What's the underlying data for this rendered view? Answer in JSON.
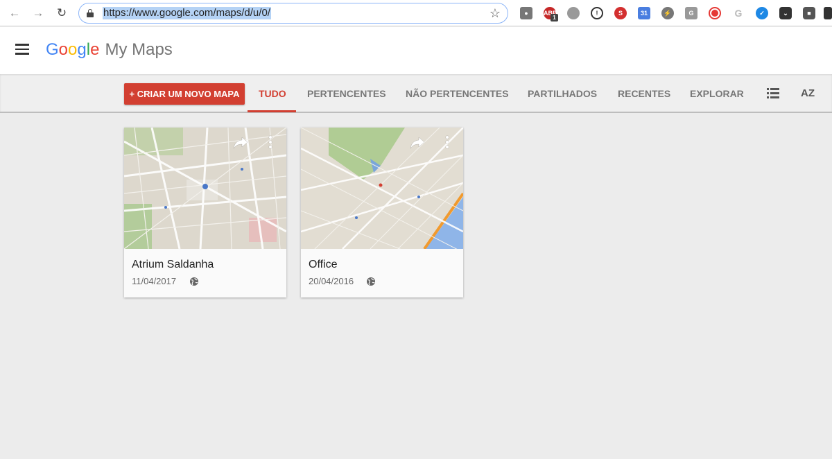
{
  "browser": {
    "url": "https://www.google.com/maps/d/u/0/",
    "extensions": [
      "camera-icon",
      "adblock-icon",
      "circle-icon",
      "info-icon",
      "stamp-icon",
      "calendar-icon",
      "bolt-icon",
      "grammarly-icon",
      "record-icon",
      "google-icon",
      "check-icon",
      "pocket-icon",
      "incognito-icon",
      "screenshot-icon"
    ],
    "adblock_badge": "1"
  },
  "header": {
    "brand_letters": [
      "G",
      "o",
      "o",
      "g",
      "l",
      "e"
    ],
    "product": "My Maps"
  },
  "toolbar": {
    "create_label": "+ CRIAR UM NOVO MAPA",
    "tabs": [
      {
        "label": "TUDO",
        "active": true
      },
      {
        "label": "PERTENCENTES",
        "active": false
      },
      {
        "label": "NÃO PERTENCENTES",
        "active": false
      },
      {
        "label": "PARTILHADOS",
        "active": false
      },
      {
        "label": "RECENTES",
        "active": false
      },
      {
        "label": "EXPLORAR",
        "active": false
      }
    ],
    "sort_label": "AZ",
    "accent_color": "#d23f31"
  },
  "maps": [
    {
      "title": "Atrium Saldanha",
      "date": "11/04/2017",
      "visibility": "globe-icon"
    },
    {
      "title": "Office",
      "date": "20/04/2016",
      "visibility": "globe-icon"
    }
  ]
}
